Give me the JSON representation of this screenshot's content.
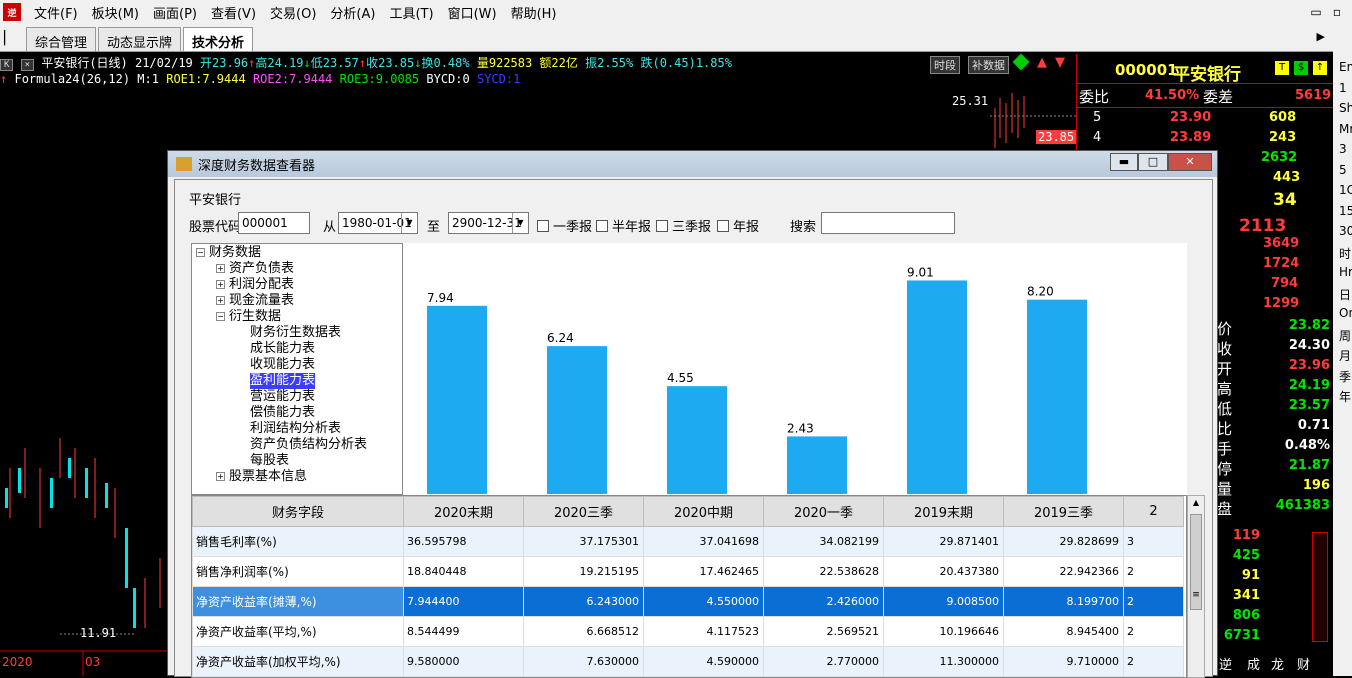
{
  "menubar": {
    "items": [
      "文件(F)",
      "板块(M)",
      "画面(P)",
      "查看(V)",
      "交易(O)",
      "分析(A)",
      "工具(T)",
      "窗口(W)",
      "帮助(H)"
    ],
    "logo": "逆"
  },
  "tabs": [
    "综合管理",
    "动态显示牌",
    "技术分析"
  ],
  "infobar": {
    "stock": "平安银行(日线) 21/02/19",
    "open": "开23.96",
    "high": "高24.19",
    "low": "低23.57",
    "close": "收23.85",
    "turnover": "换0.48%",
    "volume": "量922583",
    "amount": "额22亿",
    "amplitude": "振2.55%",
    "change": "跌(0.45)1.85%",
    "btn_period": "时段",
    "btn_fill": "补数据"
  },
  "formula": {
    "name": "Formula24(26,12)",
    "m": "M:1",
    "roe1": "ROE1:7.9444",
    "roe2": "ROE2:7.9444",
    "roe3": "ROE3:9.0085",
    "bycd": "BYCD:0",
    "sycd": "SYCD:1"
  },
  "kline": {
    "high_label": "25.31",
    "price_tag": "23.85",
    "low_label": "11.91",
    "x_label_1": "2020",
    "x_label_2": "03"
  },
  "quote": {
    "code": "000001",
    "name": "平安银行",
    "weibi_label": "委比",
    "weibi": "41.50%",
    "weicha_label": "委差",
    "weicha": "5619",
    "asks": [
      {
        "level": "5",
        "price": "23.90",
        "vol": "608"
      },
      {
        "level": "4",
        "price": "23.89",
        "vol": "243"
      }
    ],
    "partial_values": [
      "2632",
      "443",
      "34",
      "2113",
      "3649",
      "1724",
      "794",
      "1299"
    ],
    "stats": [
      {
        "label": "价",
        "value": "23.82"
      },
      {
        "label": "收",
        "value": "24.30"
      },
      {
        "label": "开",
        "value": "23.96"
      },
      {
        "label": "高",
        "value": "24.19"
      },
      {
        "label": "低",
        "value": "23.57"
      },
      {
        "label": "比",
        "value": "0.71"
      },
      {
        "label": "手",
        "value": "0.48%"
      },
      {
        "label": "停",
        "value": "21.87"
      },
      {
        "label": "量",
        "value": "196"
      },
      {
        "label": "盘",
        "value": "461383"
      }
    ],
    "ticks": [
      "119",
      "425",
      "91",
      "341",
      "806",
      "6731"
    ],
    "bottom_tabs": [
      "逆",
      "成",
      "龙",
      "财"
    ]
  },
  "edgestrip": [
    "En",
    "1",
    "Sh",
    "Mr",
    "3",
    "5",
    "1C",
    "15",
    "30",
    "时",
    "Hr",
    "日",
    "On",
    "周",
    "月",
    "季",
    "年"
  ],
  "dialog": {
    "title": "深度财务数据查看器",
    "stock_name": "平安银行",
    "code_label": "股票代码",
    "code_value": "000001",
    "from_label": "从",
    "from_value": "1980-01-01",
    "to_label": "至",
    "to_value": "2900-12-31",
    "checkboxes": [
      "一季报",
      "半年报",
      "三季报",
      "年报"
    ],
    "search_label": "搜索",
    "search_value": ""
  },
  "tree": {
    "root": "财务数据",
    "groups": [
      "资产负债表",
      "利润分配表",
      "现金流量表",
      "衍生数据"
    ],
    "children": [
      "财务衍生数据表",
      "成长能力表",
      "收现能力表",
      "盈利能力表",
      "营运能力表",
      "偿债能力表",
      "利润结构分析表",
      "资产负债结构分析表",
      "每股表"
    ],
    "selected": "盈利能力表",
    "last": "股票基本信息"
  },
  "chart_data": {
    "type": "bar",
    "categories": [
      "2020末期",
      "2020三季",
      "2020中期",
      "2020一季",
      "2019末期",
      "2019三季"
    ],
    "values": [
      7.94,
      6.24,
      4.55,
      2.43,
      9.01,
      8.2
    ],
    "labels": [
      "7.94",
      "6.24",
      "4.55",
      "2.43",
      "9.01",
      "8.20"
    ],
    "ylim": [
      0,
      10
    ],
    "color": "#1eaaf0",
    "title": "",
    "xlabel": "",
    "ylabel": ""
  },
  "table": {
    "header_field": "财务字段",
    "columns": [
      "2020末期",
      "2020三季",
      "2020中期",
      "2020一季",
      "2019末期",
      "2019三季",
      "2"
    ],
    "rows": [
      {
        "field": "销售毛利率(%)",
        "values": [
          "36.595798",
          "37.175301",
          "37.041698",
          "34.082199",
          "29.871401",
          "29.828699",
          "3"
        ]
      },
      {
        "field": "销售净利润率(%)",
        "values": [
          "18.840448",
          "19.215195",
          "17.462465",
          "22.538628",
          "20.437380",
          "22.942366",
          "2"
        ]
      },
      {
        "field": "净资产收益率(摊薄,%)",
        "values": [
          "7.944400",
          "6.243000",
          "4.550000",
          "2.426000",
          "9.008500",
          "8.199700",
          "2"
        ]
      },
      {
        "field": "净资产收益率(平均,%)",
        "values": [
          "8.544499",
          "6.668512",
          "4.117523",
          "2.569521",
          "10.196646",
          "8.945400",
          "2"
        ]
      },
      {
        "field": "净资产收益率(加权平均,%)",
        "values": [
          "9.580000",
          "7.630000",
          "4.590000",
          "2.770000",
          "11.300000",
          "9.710000",
          "2"
        ]
      }
    ]
  }
}
